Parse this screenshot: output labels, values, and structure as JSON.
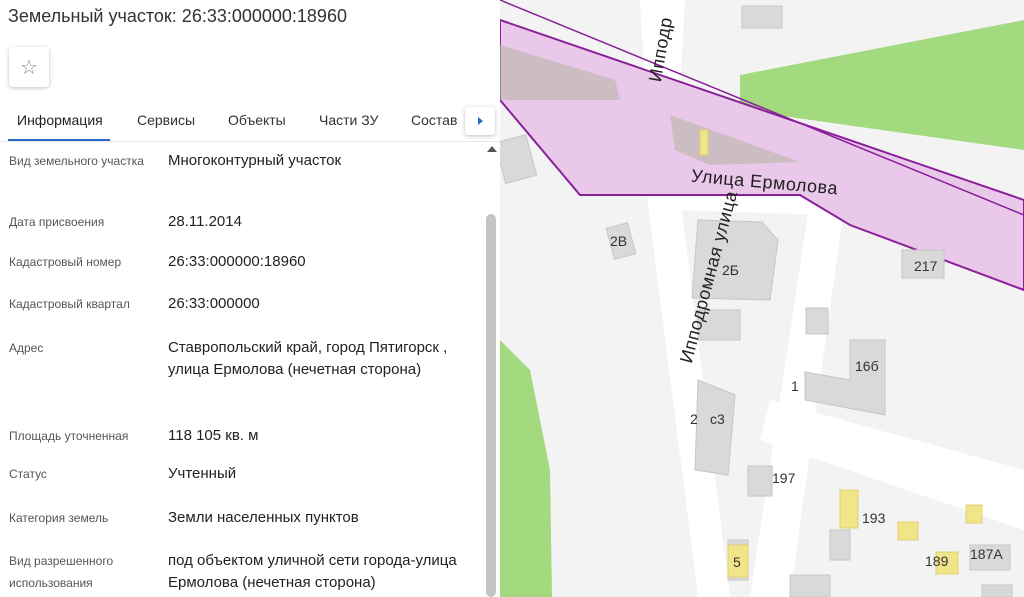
{
  "panel": {
    "title": "Земельный участок: 26:33:000000:18960",
    "favorite_icon": "☆"
  },
  "tabs": [
    {
      "label": "Информация",
      "active": true
    },
    {
      "label": "Сервисы",
      "active": false
    },
    {
      "label": "Объекты",
      "active": false
    },
    {
      "label": "Части ЗУ",
      "active": false
    },
    {
      "label": "Состав",
      "active": false
    }
  ],
  "info": [
    {
      "label": "Вид земельного участка",
      "value": "Многоконтурный участок"
    },
    {
      "label": "Дата присвоения",
      "value": "28.11.2014"
    },
    {
      "label": "Кадастровый номер",
      "value": "26:33:000000:18960"
    },
    {
      "label": "Кадастровый квартал",
      "value": "26:33:000000"
    },
    {
      "label": "Адрес",
      "value": "Ставропольский край, город Пятигорск , улица Ермолова (нечетная сторона)"
    },
    {
      "label": "Площадь уточненная",
      "value": "118 105 кв. м"
    },
    {
      "label": "Статус",
      "value": "Учтенный"
    },
    {
      "label": "Категория земель",
      "value": "Земли населенных пунктов"
    },
    {
      "label": "Вид разрешенного использования",
      "value": "под объектом уличной сети города-улица Ермолова (нечетная сторона)"
    }
  ],
  "map": {
    "streets": {
      "ermolova": "Улица Ермолова",
      "ippodromnaya": "Ипподромная улица",
      "ippodr_top": "Ипподр"
    },
    "houses": [
      "2В",
      "2Б",
      "217",
      "16б",
      "1",
      "2",
      "с3",
      "197",
      "193",
      "189",
      "187А",
      "5"
    ],
    "colors": {
      "parcel_fill": "#e9c8ea",
      "parcel_border": "#8a1f9a",
      "green": "#a3d97f",
      "building": "#d9d9d9",
      "building_yellow": "#f1e58a"
    }
  }
}
